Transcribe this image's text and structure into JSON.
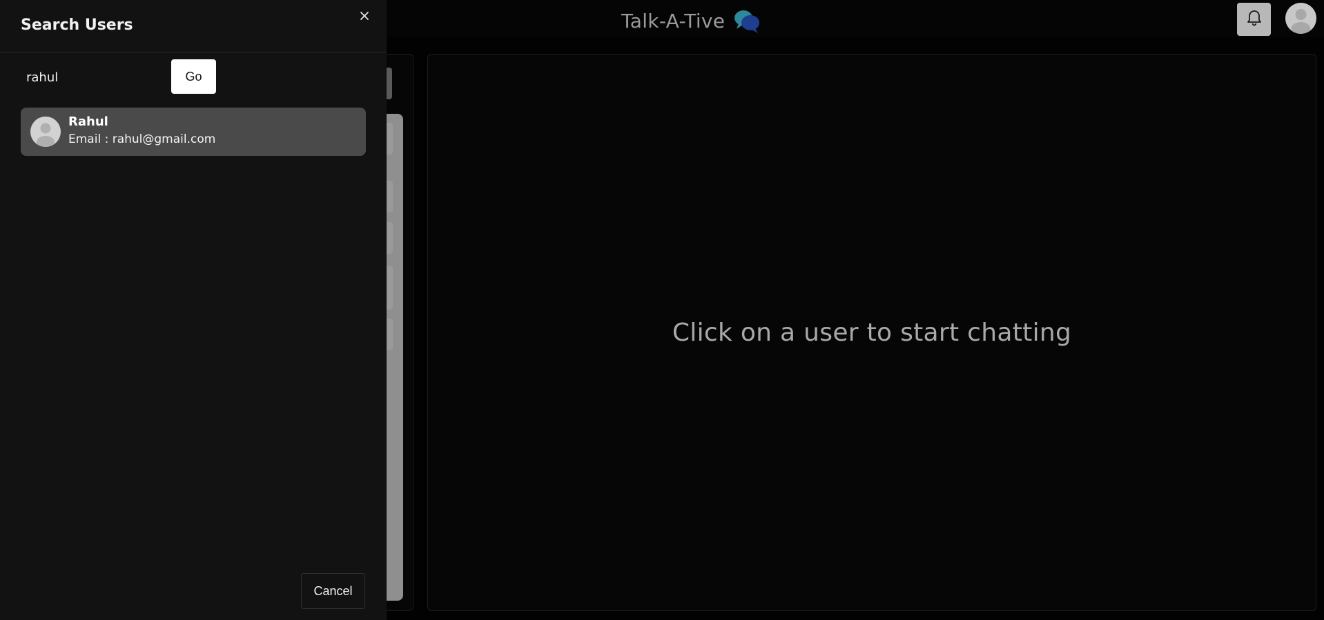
{
  "header": {
    "app_title": "Talk-A-Tive",
    "brand_icon": "chat-bubbles-icon",
    "notification_icon": "bell-icon",
    "profile_icon": "avatar"
  },
  "chat_area": {
    "empty_message": "Click on a user to start chatting"
  },
  "drawer": {
    "title": "Search Users",
    "close_icon": "close-icon",
    "search": {
      "value": "rahul",
      "placeholder": ""
    },
    "go_label": "Go",
    "results": [
      {
        "name": "Rahul",
        "email_line": "Email : rahul@gmail.com"
      }
    ],
    "cancel_label": "Cancel"
  },
  "colors": {
    "background": "#020202",
    "drawer_bg": "#121212",
    "result_bg": "#4a4a4a",
    "title_text": "#9a9a9a",
    "brand_blue": "#1e3f8f",
    "brand_teal": "#2c8a9a"
  }
}
